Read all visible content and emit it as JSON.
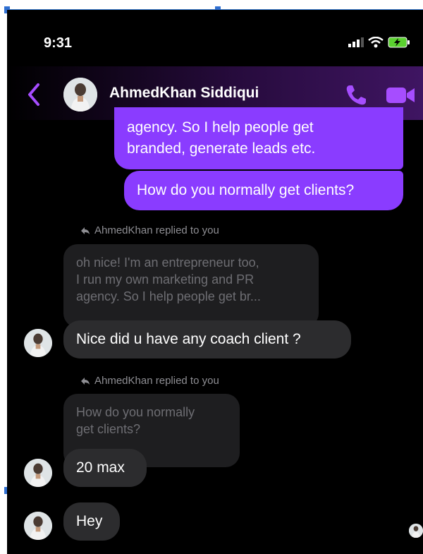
{
  "status_bar": {
    "time": "9:31"
  },
  "header": {
    "contact_name": "AhmedKhan Siddiqui",
    "icons": [
      "back-chevron-icon",
      "phone-icon",
      "video-camera-icon"
    ],
    "accent_color": "#a64dff"
  },
  "messages": {
    "sent_1": {
      "line_1": "agency. So I help people get",
      "line_2": "branded, generate leads etc."
    },
    "sent_2": {
      "text": "How do you normally get clients?"
    },
    "reply_1": {
      "tag": "AhmedKhan replied to you",
      "quoted_line_1": "oh nice! I'm an entrepreneur too,",
      "quoted_line_2": "I run my own marketing and PR",
      "quoted_line_3": "agency. So I help people get br...",
      "text": "Nice did u have any coach client ?"
    },
    "reply_2": {
      "tag": "AhmedKhan replied to you",
      "quoted_line_1": "How do you normally",
      "quoted_line_2": "get clients?",
      "text": "20 max"
    },
    "received_3": {
      "text": "Hey"
    }
  },
  "colors": {
    "sent_bubble": "#8a3cff",
    "received_bubble": "#2c2c2e",
    "background": "#000000"
  }
}
